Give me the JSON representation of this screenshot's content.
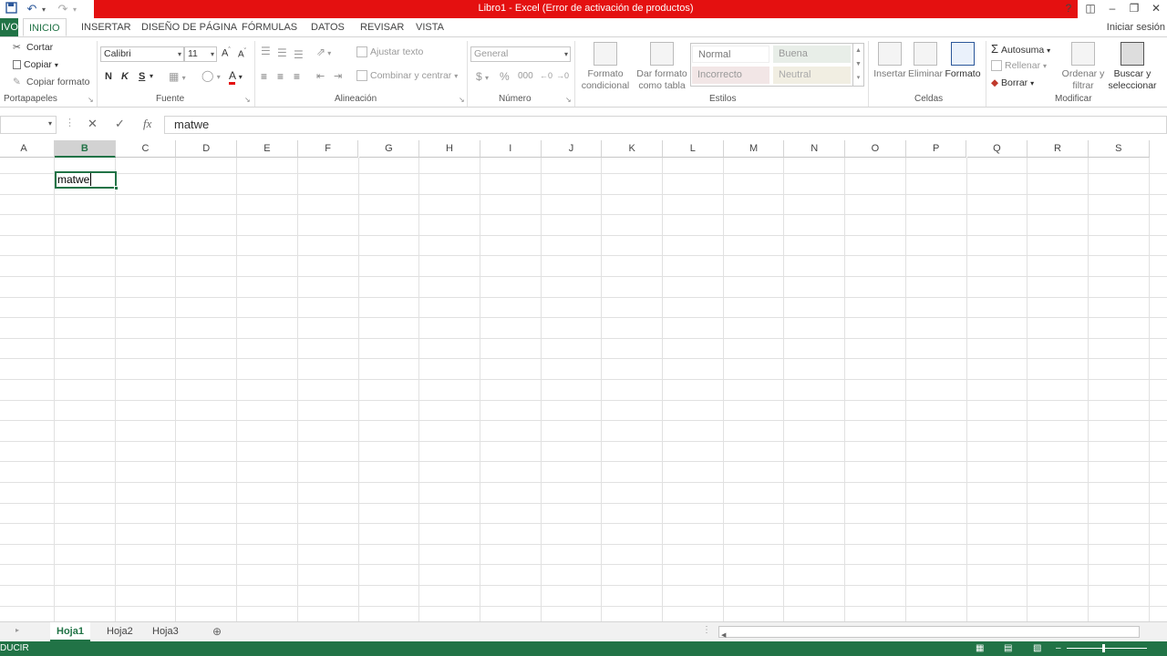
{
  "qat": {
    "save_icon": "save-icon",
    "undo_icon": "undo-icon",
    "redo_icon": "redo-icon"
  },
  "window": {
    "title": "Libro1 -  Excel (Error de activación de productos)",
    "help": "?"
  },
  "tabs": {
    "file": "IVO",
    "items": [
      "INICIO",
      "INSERTAR",
      "DISEÑO DE PÁGINA",
      "FÓRMULAS",
      "DATOS",
      "REVISAR",
      "VISTA"
    ],
    "signin": "Iniciar sesión"
  },
  "clipboard": {
    "cut": "Cortar",
    "copy": "Copiar",
    "format_painter": "Copiar formato",
    "label": "Portapapeles"
  },
  "font": {
    "name": "Calibri",
    "size": "11",
    "bold": "N",
    "italic": "K",
    "underline": "S",
    "label": "Fuente"
  },
  "alignment": {
    "wrap": "Ajustar texto",
    "merge": "Combinar y centrar",
    "label": "Alineación"
  },
  "number": {
    "format": "General",
    "currency": "$",
    "percent": "%",
    "label": "Número"
  },
  "styles": {
    "cond_format": "Formato condicional",
    "table_format": "Dar formato como tabla",
    "normal": "Normal",
    "good": "Buena",
    "bad": "Incorrecto",
    "neutral": "Neutral",
    "label": "Estilos"
  },
  "cells": {
    "insert": "Insertar",
    "delete": "Eliminar",
    "format": "Formato",
    "label": "Celdas"
  },
  "editing": {
    "autosum": "Autosuma",
    "fill": "Rellenar",
    "clear": "Borrar",
    "sort": "Ordenar y filtrar",
    "find": "Buscar y seleccionar",
    "label": "Modificar"
  },
  "formula_bar": {
    "fx": "fx",
    "value": "matwe"
  },
  "columns": [
    "A",
    "B",
    "C",
    "D",
    "E",
    "F",
    "G",
    "H",
    "I",
    "J",
    "K",
    "L",
    "M",
    "N",
    "O",
    "P",
    "Q",
    "R",
    "S"
  ],
  "selected_column": "B",
  "active_cell_value": "matwe",
  "sheets": [
    "Hoja1",
    "Hoja2",
    "Hoja3"
  ],
  "active_sheet": "Hoja1",
  "status": "DUCIR",
  "colors": {
    "excel_green": "#217346",
    "title_red": "#e41010"
  }
}
